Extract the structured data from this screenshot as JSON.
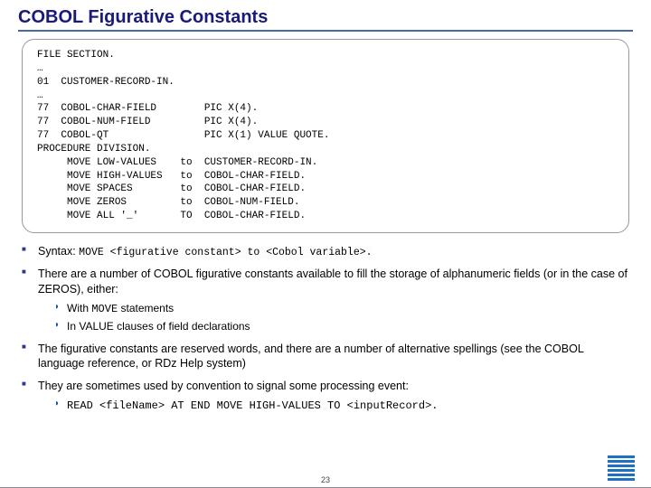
{
  "title": "COBOL Figurative Constants",
  "code": {
    "l1": "FILE SECTION.",
    "l2": "…",
    "l3": "01  CUSTOMER-RECORD-IN.",
    "l4": "…",
    "l5": "77  COBOL-CHAR-FIELD        PIC X(4).",
    "l6": "77  COBOL-NUM-FIELD         PIC X(4).",
    "l7": "77  COBOL-QT                PIC X(1) VALUE QUOTE.",
    "l8": "",
    "l9": "PROCEDURE DIVISION.",
    "l10": "     MOVE LOW-VALUES    to  CUSTOMER-RECORD-IN.",
    "l11": "     MOVE HIGH-VALUES   to  COBOL-CHAR-FIELD.",
    "l12": "     MOVE SPACES        to  COBOL-CHAR-FIELD.",
    "l13": "     MOVE ZEROS         to  COBOL-NUM-FIELD.",
    "l14": "     MOVE ALL '_'       TO  COBOL-CHAR-FIELD."
  },
  "b1": {
    "lead": "Syntax: ",
    "code": "MOVE <figurative constant> to  <Cobol variable>."
  },
  "b2": {
    "text": "There are a number of COBOL figurative constants available to fill the storage of alphanumeric fields (or in the case of ZEROS), either:",
    "s1a": "With ",
    "s1b": "MOVE",
    "s1c": " statements",
    "s2": "In VALUE clauses of field declarations"
  },
  "b3": "The figurative constants are reserved words, and there are a number of alternative spellings (see the COBOL language reference, or RDz Help system)",
  "b4": {
    "text": "They are sometimes used by convention to signal some processing event:",
    "s1": "READ <fileName>   AT END MOVE HIGH-VALUES TO <inputRecord>."
  },
  "page": "23",
  "logo_alt": "IBM"
}
